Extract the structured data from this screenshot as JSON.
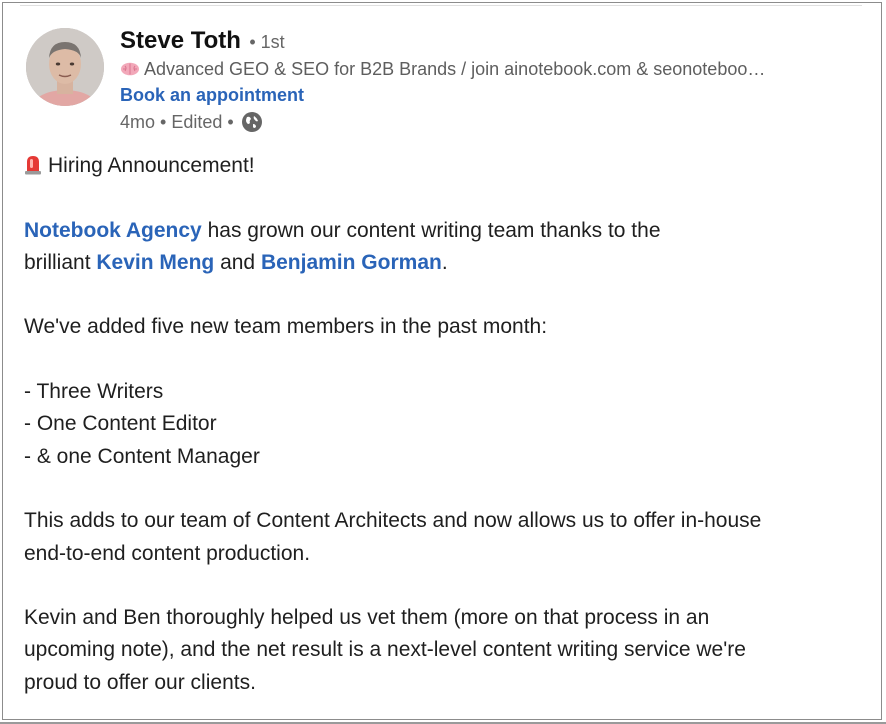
{
  "post": {
    "author": {
      "name": "Steve Toth",
      "degree": "• 1st",
      "headline": "Advanced GEO & SEO for B2B Brands / join ainotebook.com & seonoteboo…",
      "headline_icon": "brain-icon",
      "cta_link": "Book an appointment",
      "timestamp": "4mo • Edited •",
      "visibility_icon": "globe-icon"
    },
    "title_icon": "siren-icon",
    "title": "Hiring Announcement!",
    "para1": {
      "mention1": "Notebook Agency",
      "text1": " has grown our content writing team thanks to the",
      "text2": "brilliant ",
      "mention2": "Kevin Meng",
      "text3": " and ",
      "mention3": "Benjamin Gorman",
      "text4": "."
    },
    "para2": "We've added five new team members in the past month:",
    "list": [
      "- Three Writers",
      "- One Content Editor",
      "- & one Content Manager"
    ],
    "para3": {
      "line1": "This adds to our team of Content Architects and now allows us to offer in-house",
      "line2": "end-to-end content production."
    },
    "para4": {
      "line1": "Kevin and Ben thoroughly helped us vet them (more on that process in an",
      "line2": "upcoming note), and the net result is a next-level content writing service we're",
      "line3": "proud to offer our clients."
    }
  },
  "colors": {
    "link": "#2a64b8",
    "text": "#1f1f1f",
    "muted": "#666666"
  }
}
